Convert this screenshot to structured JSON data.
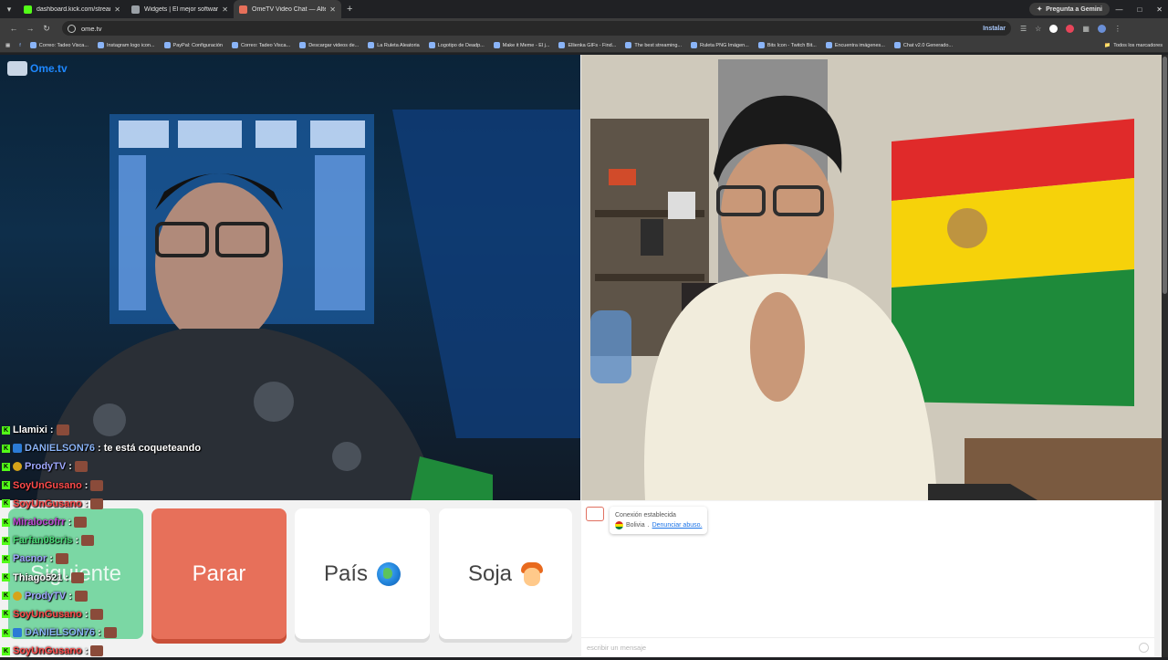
{
  "browser": {
    "tabs": [
      {
        "label": "dashboard.kick.com/stream",
        "color": "#53fc18",
        "active": false
      },
      {
        "label": "Widgets | El mejor software pa",
        "color": "#9aa0a6",
        "active": false
      },
      {
        "label": "OmeTV Video Chat — Altern",
        "color": "#e7705a",
        "active": true
      }
    ],
    "gemini_label": "Pregunta a Gemini",
    "url": "ome.tv",
    "install_label": "Instalar",
    "bookmarks": [
      "Correo: Tadeo Visca...",
      "Instagram logo icon...",
      "PayPal: Configuración",
      "Correo: Tadeo Visca...",
      "Descargar videos de...",
      "La Ruleta Aleatoria",
      "Logotipo de Deadp...",
      "Make it Meme - El j...",
      "Ellienka GIFs - Find...",
      "The best streaming...",
      "Ruleta PNG Imágen...",
      "Bits Icon - Twitch Bit...",
      "Encuentra imágenes...",
      "Chat v2.0 Generado..."
    ],
    "all_bookmarks": "Todos los marcadores"
  },
  "app": {
    "logo_text": "Ome.tv",
    "buttons": {
      "next": "Siguiente",
      "stop": "Parar",
      "country": "País",
      "gender": "Soja"
    },
    "chat": {
      "status": "Conexión establecida",
      "country": "Bolivia",
      "report": "Denunciar abuso.",
      "input_placeholder": "escribir un mensaje"
    }
  },
  "stream_overlay": [
    {
      "user": "Llamixi",
      "color": "#ffffff",
      "badge": "none",
      "message": ""
    },
    {
      "user": "DANIELSON76",
      "color": "#8ab4f8",
      "badge": "blue",
      "message": "te está coqueteando"
    },
    {
      "user": "ProdyTV",
      "color": "#9fa8ff",
      "badge": "gold",
      "message": ""
    },
    {
      "user": "SoyUnGusano",
      "color": "#ff4b4b",
      "badge": "none",
      "message": ""
    },
    {
      "user": "SoyUnGusano",
      "color": "#ff4b4b",
      "badge": "none",
      "message": ""
    },
    {
      "user": "Miralocofrr",
      "color": "#c04bd6",
      "badge": "none",
      "message": ""
    },
    {
      "user": "Farfan08cris",
      "color": "#4be07a",
      "badge": "none",
      "message": ""
    },
    {
      "user": "Pacnor",
      "color": "#9fa8ff",
      "badge": "none",
      "message": ""
    },
    {
      "user": "Thiago521",
      "color": "#ffffff",
      "badge": "none",
      "message": ""
    },
    {
      "user": "ProdyTV",
      "color": "#9fa8ff",
      "badge": "gold",
      "message": ""
    },
    {
      "user": "SoyUnGusano",
      "color": "#ff4b4b",
      "badge": "none",
      "message": ""
    },
    {
      "user": "DANIELSON76",
      "color": "#8ab4f8",
      "badge": "blue",
      "message": ""
    },
    {
      "user": "SoyUnGusano",
      "color": "#ff4b4b",
      "badge": "none",
      "message": ""
    }
  ],
  "colors": {
    "next": "#7bd7a4",
    "stop": "#e7705a",
    "brand": "#1e88ff"
  }
}
